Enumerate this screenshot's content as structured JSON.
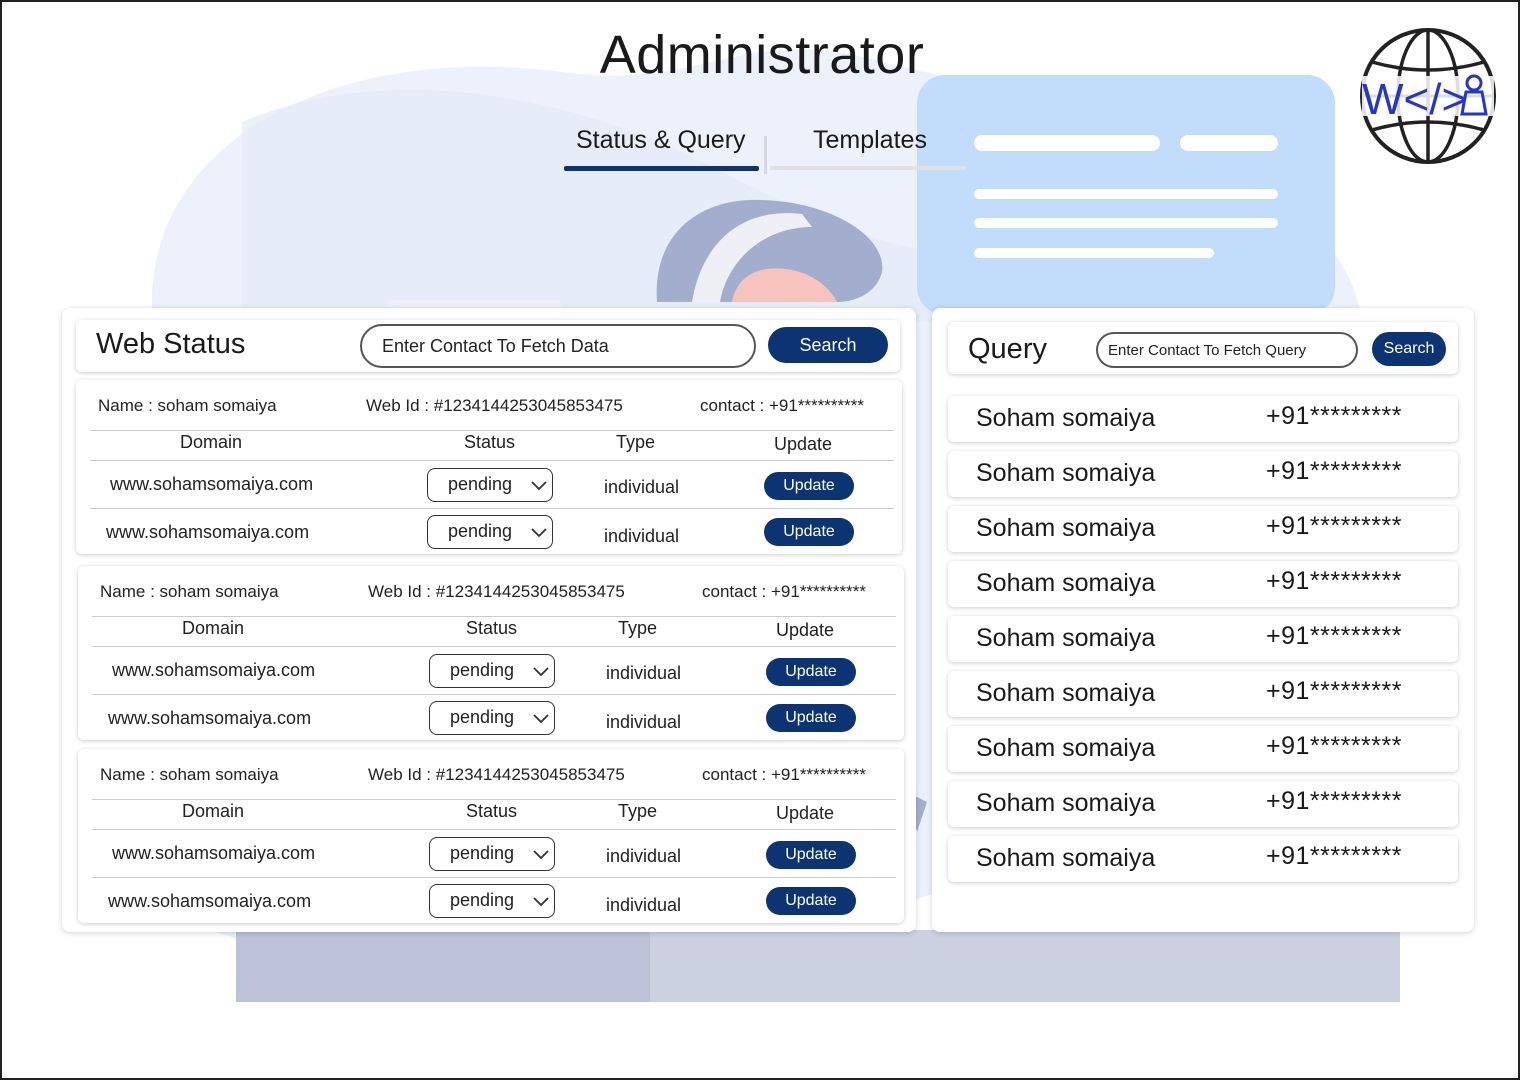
{
  "page": {
    "title": "Administrator"
  },
  "tabs": [
    {
      "label": "Status & Query",
      "active": true
    },
    {
      "label": "Templates",
      "active": false
    }
  ],
  "logo": {
    "text": "W</>",
    "icon": "globe-code-logo"
  },
  "colors": {
    "primary": "#0d3472",
    "bg_shape": "#e9eefa",
    "bg_card": "#c2dcfc",
    "bg_desk": "#bcc3d8"
  },
  "web_status": {
    "title": "Web Status",
    "search_placeholder": "Enter Contact To Fetch Data",
    "search_label": "Search",
    "records": [
      {
        "name": "Name : soham somaiya",
        "web_id": "Web Id : #1234144253045853475",
        "contact": "contact : +91**********",
        "headers": {
          "domain": "Domain",
          "status": "Status",
          "type": "Type",
          "update": "Update"
        },
        "rows": [
          {
            "domain": "www.sohamsomaiya.com",
            "status": "pending",
            "type": "individual",
            "action": "Update"
          },
          {
            "domain": "www.sohamsomaiya.com",
            "status": "pending",
            "type": "individual",
            "action": "Update"
          }
        ]
      },
      {
        "name": "Name : soham somaiya",
        "web_id": "Web Id : #1234144253045853475",
        "contact": "contact : +91**********",
        "headers": {
          "domain": "Domain",
          "status": "Status",
          "type": "Type",
          "update": "Update"
        },
        "rows": [
          {
            "domain": "www.sohamsomaiya.com",
            "status": "pending",
            "type": "individual",
            "action": "Update"
          },
          {
            "domain": "www.sohamsomaiya.com",
            "status": "pending",
            "type": "individual",
            "action": "Update"
          }
        ]
      },
      {
        "name": "Name : soham somaiya",
        "web_id": "Web Id : #1234144253045853475",
        "contact": "contact : +91**********",
        "headers": {
          "domain": "Domain",
          "status": "Status",
          "type": "Type",
          "update": "Update"
        },
        "rows": [
          {
            "domain": "www.sohamsomaiya.com",
            "status": "pending",
            "type": "individual",
            "action": "Update"
          },
          {
            "domain": "www.sohamsomaiya.com",
            "status": "pending",
            "type": "individual",
            "action": "Update"
          }
        ]
      }
    ]
  },
  "query": {
    "title": "Query",
    "search_placeholder": "Enter Contact To Fetch Query",
    "search_label": "Search",
    "items": [
      {
        "name": "Soham somaiya",
        "contact": "+91*********"
      },
      {
        "name": "Soham somaiya",
        "contact": "+91*********"
      },
      {
        "name": "Soham somaiya",
        "contact": "+91*********"
      },
      {
        "name": "Soham somaiya",
        "contact": "+91*********"
      },
      {
        "name": "Soham somaiya",
        "contact": "+91*********"
      },
      {
        "name": "Soham somaiya",
        "contact": "+91*********"
      },
      {
        "name": "Soham somaiya",
        "contact": "+91*********"
      },
      {
        "name": "Soham somaiya",
        "contact": "+91*********"
      },
      {
        "name": "Soham somaiya",
        "contact": "+91*********"
      }
    ]
  }
}
